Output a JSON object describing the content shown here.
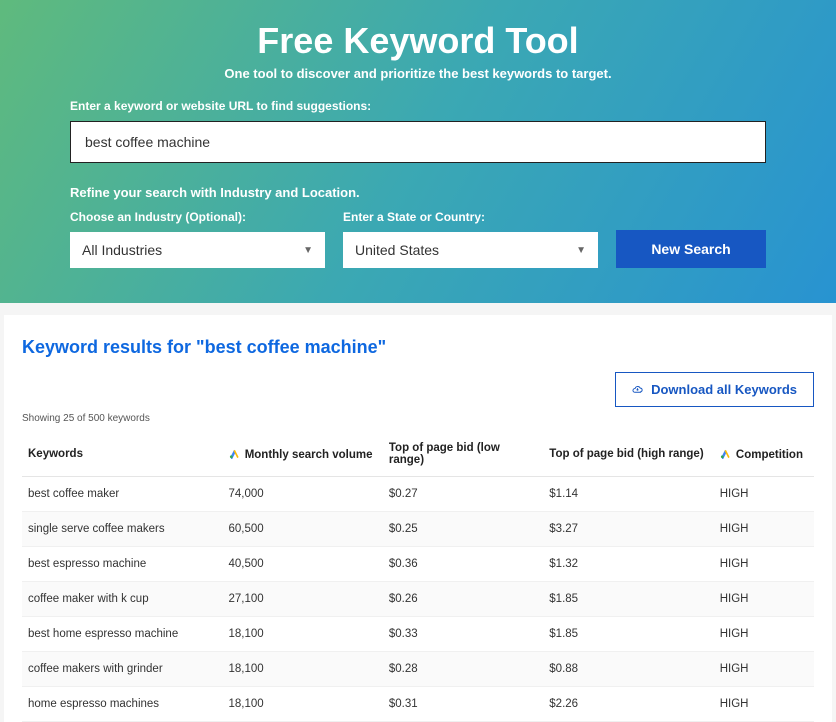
{
  "hero": {
    "title": "Free Keyword Tool",
    "subtitle": "One tool to discover and prioritize the best keywords to target.",
    "input_label": "Enter a keyword or website URL to find suggestions:",
    "input_value": "best coffee machine",
    "refine_label": "Refine your search with Industry and Location.",
    "industry_label": "Choose an Industry (Optional):",
    "industry_value": "All Industries",
    "location_label": "Enter a State or Country:",
    "location_value": "United States",
    "search_button": "New Search"
  },
  "results": {
    "title": "Keyword results for \"best coffee machine\"",
    "download_button": "Download all Keywords",
    "counts": "Showing 25 of 500 keywords",
    "columns": {
      "keywords": "Keywords",
      "volume": "Monthly search volume",
      "bid_low": "Top of page bid (low range)",
      "bid_high": "Top of page bid (high range)",
      "competition": "Competition"
    },
    "rows": [
      {
        "kw": "best coffee maker",
        "vol": "74,000",
        "low": "$0.27",
        "high": "$1.14",
        "comp": "HIGH"
      },
      {
        "kw": "single serve coffee makers",
        "vol": "60,500",
        "low": "$0.25",
        "high": "$3.27",
        "comp": "HIGH"
      },
      {
        "kw": "best espresso machine",
        "vol": "40,500",
        "low": "$0.36",
        "high": "$1.32",
        "comp": "HIGH"
      },
      {
        "kw": "coffee maker with k cup",
        "vol": "27,100",
        "low": "$0.26",
        "high": "$1.85",
        "comp": "HIGH"
      },
      {
        "kw": "best home espresso machine",
        "vol": "18,100",
        "low": "$0.33",
        "high": "$1.85",
        "comp": "HIGH"
      },
      {
        "kw": "coffee makers with grinder",
        "vol": "18,100",
        "low": "$0.28",
        "high": "$0.88",
        "comp": "HIGH"
      },
      {
        "kw": "home espresso machines",
        "vol": "18,100",
        "low": "$0.31",
        "high": "$2.26",
        "comp": "HIGH"
      }
    ]
  }
}
